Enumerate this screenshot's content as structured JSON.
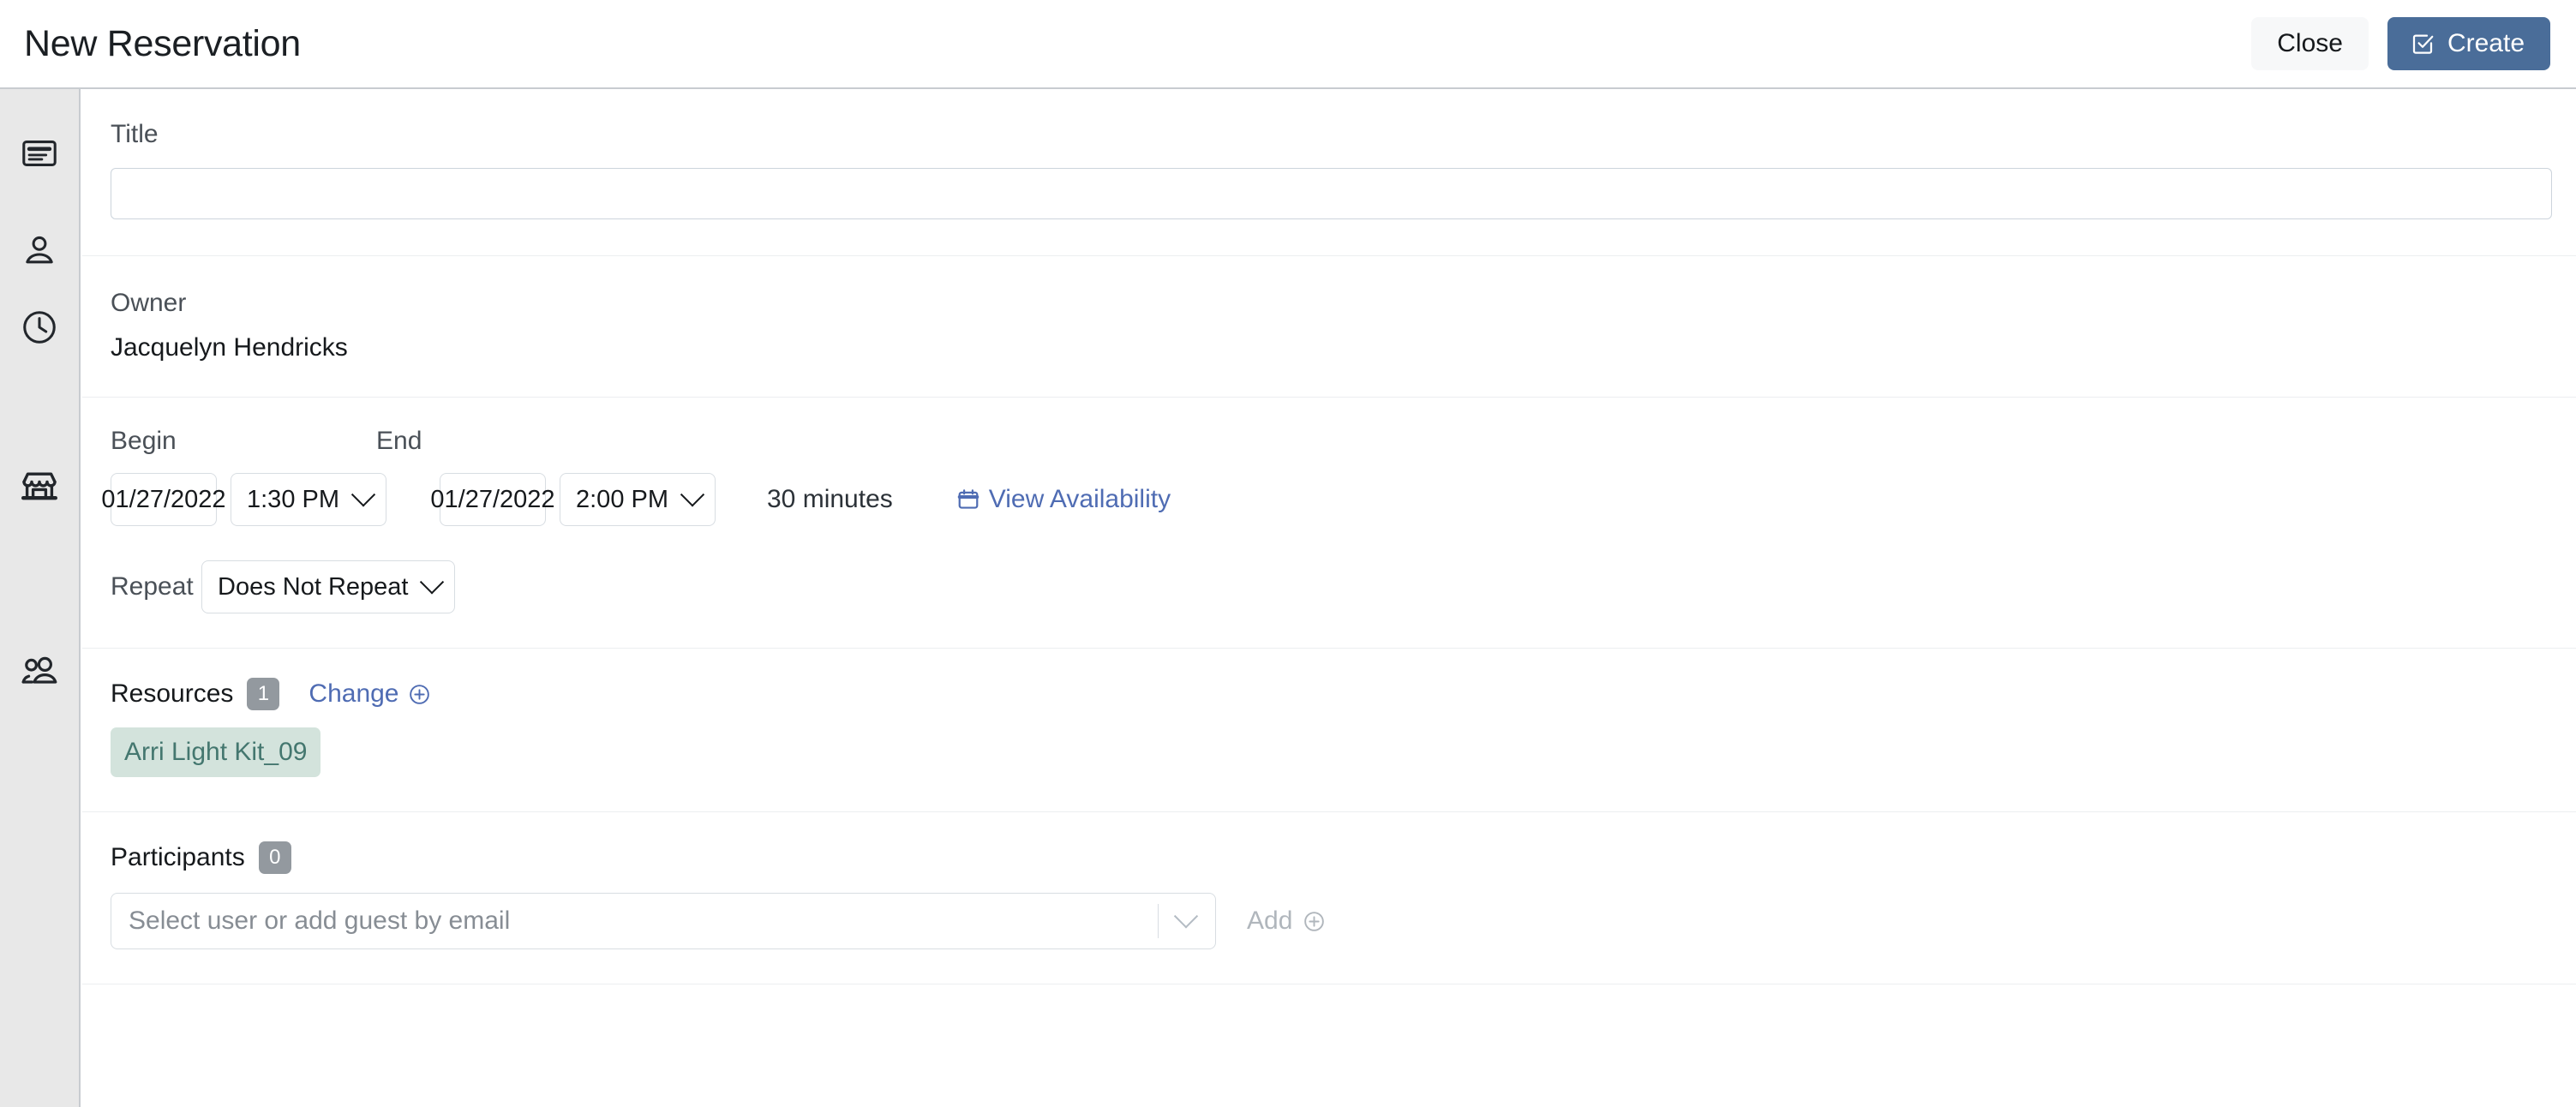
{
  "header": {
    "title": "New Reservation",
    "close_label": "Close",
    "create_label": "Create",
    "create_icon": "checkbox-check-icon",
    "create_bg": "#4a6d99"
  },
  "rail": {
    "items": [
      {
        "icon": "title-card-icon",
        "name": "details"
      },
      {
        "icon": "person-icon",
        "name": "owner"
      },
      {
        "icon": "clock-icon",
        "name": "time"
      },
      {
        "icon": "storefront-icon",
        "name": "resources"
      },
      {
        "icon": "people-icon",
        "name": "participants"
      }
    ]
  },
  "form": {
    "title": {
      "label": "Title",
      "value": "",
      "placeholder": ""
    },
    "owner": {
      "label": "Owner",
      "value": "Jacquelyn Hendricks"
    },
    "schedule": {
      "begin_label": "Begin",
      "end_label": "End",
      "begin_date": "01/27/2022",
      "begin_time": "1:30 PM",
      "end_date": "01/27/2022",
      "end_time": "2:00 PM",
      "duration": "30 minutes",
      "availability_label": "View Availability",
      "availability_icon": "calendar-icon",
      "link_color": "#4f6cb3"
    },
    "repeat": {
      "label": "Repeat",
      "value": "Does Not Repeat"
    },
    "resources": {
      "label": "Resources",
      "count": "1",
      "change_label": "Change",
      "change_icon": "plus-circle-icon",
      "items": [
        {
          "name": "Arri Light Kit_09"
        }
      ],
      "chip_bg": "#d3e3dc",
      "chip_fg": "#44776f"
    },
    "participants": {
      "label": "Participants",
      "count": "0",
      "select_placeholder": "Select user or add guest by email",
      "select_value": "",
      "add_label": "Add",
      "add_icon": "plus-circle-icon"
    }
  }
}
